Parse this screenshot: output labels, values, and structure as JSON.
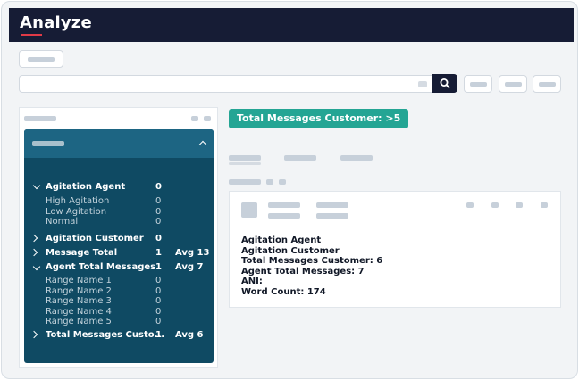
{
  "header": {
    "title": "Analyze"
  },
  "search": {
    "placeholder": ""
  },
  "filter_chip": {
    "label": "Total Messages Customer: >5"
  },
  "tree": {
    "groups": [
      {
        "label": "Agitation Agent",
        "count": "0",
        "avg": "",
        "expanded": true,
        "children": [
          {
            "label": "High Agitation",
            "count": "0"
          },
          {
            "label": "Low Agitation",
            "count": "0"
          },
          {
            "label": "Normal",
            "count": "0"
          }
        ]
      },
      {
        "label": "Agitation Customer",
        "count": "0",
        "avg": "",
        "expanded": false,
        "children": []
      },
      {
        "label": "Message Total",
        "count": "1",
        "avg": "Avg 13",
        "expanded": false,
        "children": []
      },
      {
        "label": "Agent Total Messages",
        "count": "1",
        "avg": "Avg 7",
        "expanded": true,
        "children": [
          {
            "label": "Range Name 1",
            "count": "0"
          },
          {
            "label": "Range Name 2",
            "count": "0"
          },
          {
            "label": "Range Name 3",
            "count": "0"
          },
          {
            "label": "Range Name 4",
            "count": "0"
          },
          {
            "label": "Range Name 5",
            "count": "0"
          }
        ]
      },
      {
        "label": "Total Messages Custo...",
        "count": "1",
        "avg": "Avg 6",
        "expanded": false,
        "children": []
      }
    ]
  },
  "result": {
    "lines": [
      "Agitation Agent",
      "Agitation Customer",
      "Total Messages Customer: 6",
      "Agent Total Messages: 7",
      "ANI:",
      "Word Count: 174"
    ]
  },
  "icons": {
    "search": "search-icon",
    "collapse": "chevron-up-icon",
    "expanded": "chevron-down-icon",
    "collapsed": "chevron-right-icon"
  },
  "colors": {
    "topbar": "#161c35",
    "accent": "#e03a47",
    "tree_panel": "#0f4a63",
    "tree_header": "#1d6583",
    "chip": "#24a594"
  }
}
